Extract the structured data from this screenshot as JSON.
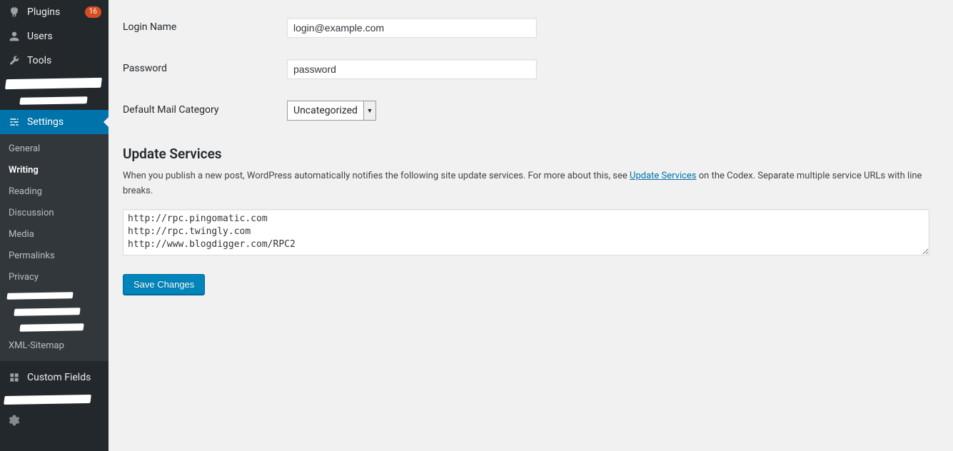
{
  "sidebar": {
    "plugins": {
      "label": "Plugins",
      "badge": "16"
    },
    "users": {
      "label": "Users"
    },
    "tools": {
      "label": "Tools"
    },
    "settings": {
      "label": "Settings"
    },
    "sub": {
      "general": "General",
      "writing": "Writing",
      "reading": "Reading",
      "discussion": "Discussion",
      "media": "Media",
      "permalinks": "Permalinks",
      "privacy": "Privacy",
      "xml_sitemap": "XML-Sitemap"
    },
    "custom_fields": {
      "label": "Custom Fields"
    }
  },
  "form": {
    "login_name": {
      "label": "Login Name",
      "value": "login@example.com"
    },
    "password": {
      "label": "Password",
      "value": "password"
    },
    "default_mail_category": {
      "label": "Default Mail Category",
      "selected": "Uncategorized"
    }
  },
  "update_services": {
    "heading": "Update Services",
    "desc_pre": "When you publish a new post, WordPress automatically notifies the following site update services. For more about this, see ",
    "desc_link": "Update Services",
    "desc_post": " on the Codex. Separate multiple service URLs with line breaks.",
    "textarea": "http://rpc.pingomatic.com\nhttp://rpc.twingly.com\nhttp://www.blogdigger.com/RPC2"
  },
  "save_button": "Save Changes"
}
